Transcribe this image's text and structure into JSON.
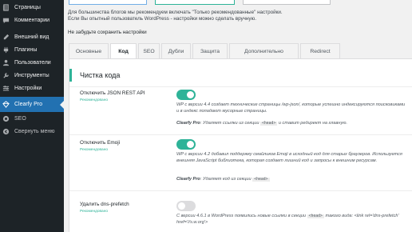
{
  "sidebar": {
    "items": [
      {
        "label": "Страницы",
        "icon": "pages-icon"
      },
      {
        "label": "Комментарии",
        "icon": "comments-icon"
      },
      {
        "label": "Внешний вид",
        "icon": "appearance-icon"
      },
      {
        "label": "Плагины",
        "icon": "plugins-icon"
      },
      {
        "label": "Пользователи",
        "icon": "users-icon"
      },
      {
        "label": "Инструменты",
        "icon": "tools-icon"
      },
      {
        "label": "Настройки",
        "icon": "settings-icon"
      },
      {
        "label": "Clearfy Pro",
        "icon": "clearfy-icon",
        "active": true
      },
      {
        "label": "SEO",
        "icon": "seo-icon"
      },
      {
        "label": "Свернуть меню",
        "icon": "collapse-menu-icon"
      }
    ]
  },
  "intro": {
    "line1": "Для большинства блогов мы рекомендуем включать \"Только рекомендованные\" настройки.",
    "line2": "Если Вы опытный пользователь WordPress - настройки можно сделать вручную.",
    "nosave": "Не забудьте сохранить настройки"
  },
  "tabs": [
    "Основные",
    "Код",
    "SEO",
    "Дубли",
    "Защита",
    "Дополнительно",
    "Redirect"
  ],
  "active_tab": "Код",
  "section_title": "Чистка кода",
  "options": [
    {
      "label": "Отключить JSON REST API",
      "badge": "Рекомендовано",
      "enabled": true,
      "desc": "WP с версии 4.4 создает технические страницы /wp-json/, которые успешно индексируются поисковиками и в индекс попадают мусорные страницы.",
      "clearfy_prefix": "Clearfy Pro",
      "clearfy_text": ": Удаляет ссылки из секции",
      "clearfy_code": "<head>",
      "clearfy_suffix": "и ставит редирект на главную."
    },
    {
      "label": "Отключить Emoji",
      "badge": "Рекомендовано",
      "enabled": true,
      "desc": "WP с версии 4.2 добавил поддержку смайликов Emoji в исходный код для старых браузеров. Используется внешняя JavaScript библиотека, которая создает лишний код и запросы к внешним ресурсам.",
      "clearfy_prefix": "Clearfy Pro",
      "clearfy_text": ": Удаляет код из секции",
      "clearfy_code": "<head>",
      "clearfy_suffix": ""
    },
    {
      "label": "Удалить dns-prefetch",
      "badge": "Рекомендовано",
      "enabled": false,
      "desc_prefix": "С версии 4.6.1 в WordPress появились новые ссылки в секции",
      "desc_code": "<head>",
      "desc_suffix": "такого вида: <link rel='dns-prefetch' href='//s.w.org'>"
    }
  ],
  "colors": {
    "sidebar_bg": "#1d2327",
    "active_item": "#2271b1",
    "toggle_on": "#2eb398",
    "toggle_off": "#dcdcde"
  }
}
